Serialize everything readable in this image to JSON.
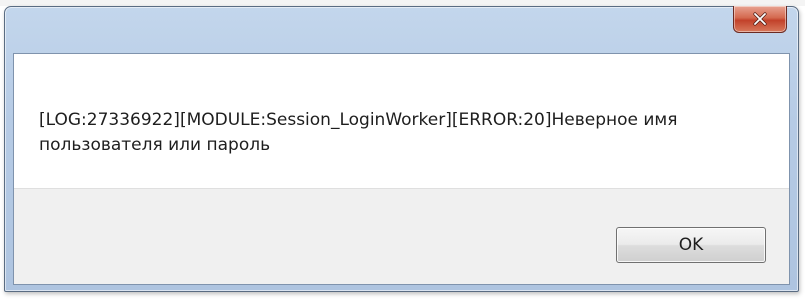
{
  "dialog": {
    "title": "",
    "close_icon": "close-icon",
    "message": "[LOG:27336922][MODULE:Session_LoginWorker][ERROR:20]Неверное имя пользователя или пароль",
    "ok_label": "OK"
  },
  "colors": {
    "titlebar": "#b9cee7",
    "close_button": "#c2412a",
    "dialog_body": "#ffffff",
    "button_area": "#f0f0f0"
  }
}
